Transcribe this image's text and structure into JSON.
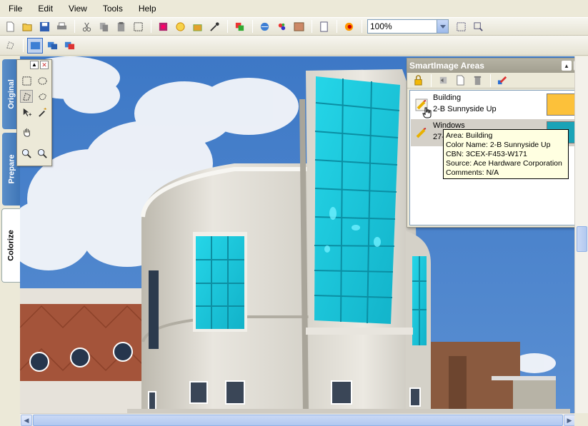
{
  "menu": [
    "File",
    "Edit",
    "View",
    "Tools",
    "Help"
  ],
  "zoom": {
    "value": "100%"
  },
  "tabs": {
    "original": "Original",
    "prepare": "Prepare",
    "colorize": "Colorize",
    "active": "Colorize"
  },
  "panel": {
    "title": "SmartImage Areas",
    "areas": [
      {
        "name": "Building",
        "color_name": "2-B Sunnyside Up",
        "swatch": "#fcc13a"
      },
      {
        "name": "Windows",
        "color_name": "27-",
        "swatch": "#1aa3b7"
      }
    ]
  },
  "tooltip": {
    "line1": "Area: Building",
    "line2": "Color Name: 2-B Sunnyside Up",
    "line3": "CBN: 3CEX-F453-W171",
    "line4": "Source: Ace Hardware Corporation",
    "line5": "Comments: N/A"
  },
  "colors": {
    "sky": "#4d84cb",
    "window_tint": "#18c2d6",
    "tab_blue": "#3d74b6",
    "swatch_building": "#fcc13a",
    "swatch_windows": "#1aa3b7"
  },
  "icons": {
    "toolbar1": [
      "new-icon",
      "open-icon",
      "save-icon",
      "print-icon",
      "cut-icon",
      "copy-icon",
      "paste-icon",
      "select-all-icon",
      "paint-icon",
      "rotate-icon",
      "fill-icon",
      "eyedropper-icon",
      "layers-icon",
      "globe-icon",
      "palette-icon",
      "picture-icon",
      "page-icon",
      "color-wheel-icon",
      "zoom-fit-icon",
      "zoom-select-icon"
    ],
    "toolbar2": [
      "lasso-icon",
      "view-original-icon",
      "view-split-icon",
      "view-colorized-icon"
    ]
  }
}
